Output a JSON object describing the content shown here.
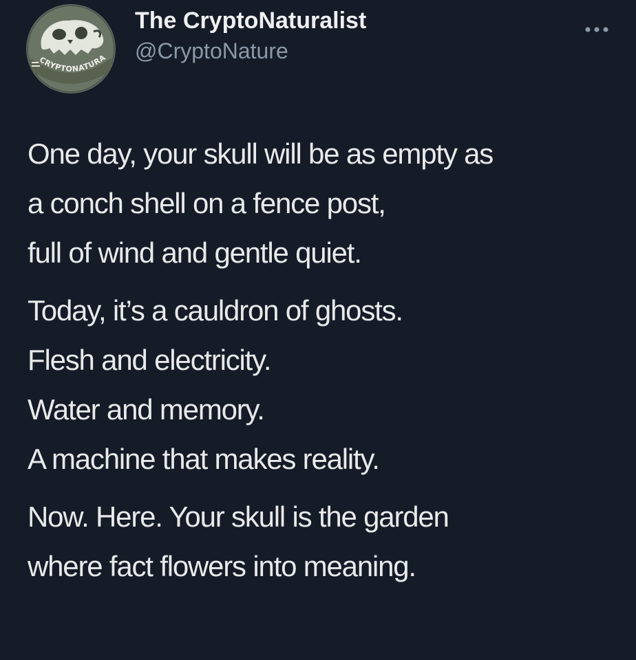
{
  "author": {
    "display_name": "The CryptoNaturalist",
    "handle": "@CryptoNature",
    "avatar_text": "CRYPTONATURALIST",
    "avatar_icon": "skull-avatar-icon"
  },
  "menu_icon": "more-options-icon",
  "tweet": {
    "stanzas": [
      [
        "One day, your skull will be as empty as",
        "a conch shell on a fence post,",
        "full of wind and gentle quiet."
      ],
      [
        "Today, it’s a cauldron of ghosts.",
        "Flesh and electricity.",
        "Water and memory.",
        "A machine that makes reality."
      ],
      [
        "Now. Here. Your skull is the garden",
        "where fact flowers into meaning."
      ]
    ]
  },
  "colors": {
    "background": "#151c28",
    "text": "#e8eaeb",
    "muted": "#8b98a5",
    "avatar_bg": "#6b7566"
  }
}
